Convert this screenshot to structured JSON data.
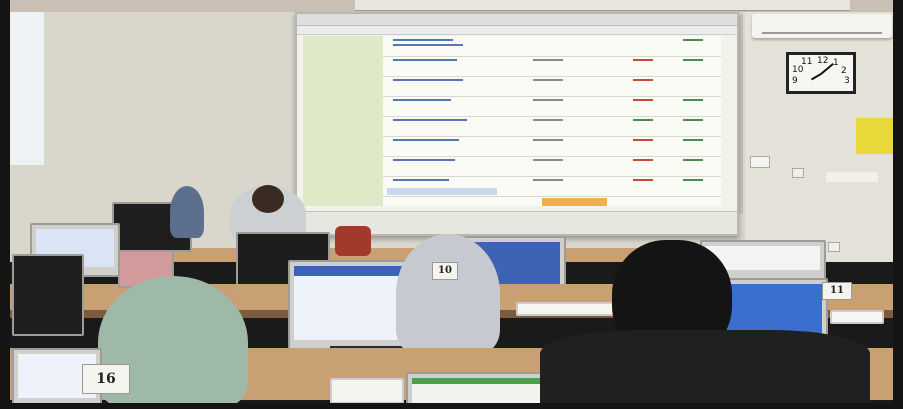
{
  "scene": {
    "labels": {
      "desk_tag_left": "16",
      "desk_tag_mid": "10",
      "desk_tag_right": "11"
    },
    "clock": {
      "numerals": [
        "12",
        "1",
        "2",
        "3",
        "9",
        "10",
        "11"
      ]
    },
    "colors": {
      "wall": "#d9d6cc",
      "desk": "#c99f74",
      "projection_accent": "#dfe9c7",
      "table_link": "#5576b3",
      "status_red": "#c74b3b",
      "status_green": "#4b8b52",
      "button_orange": "#e9b24a"
    }
  }
}
